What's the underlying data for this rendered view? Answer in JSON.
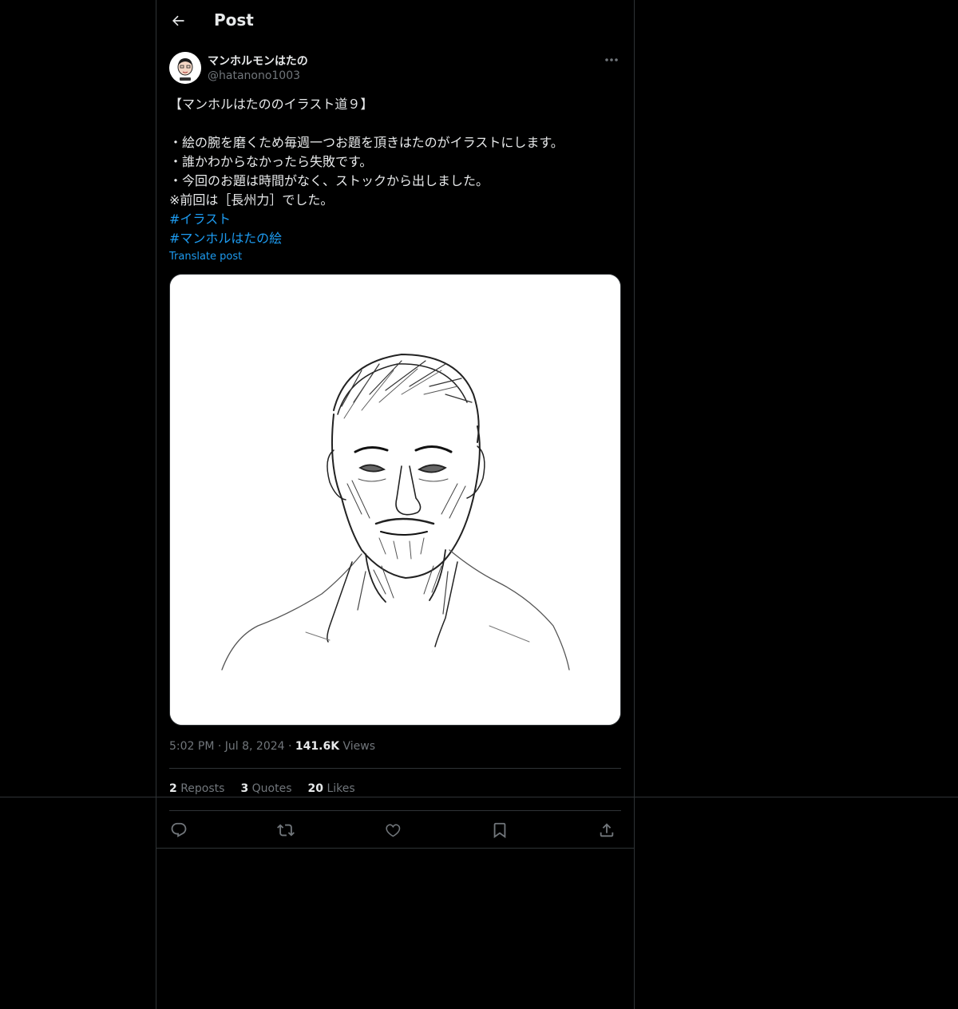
{
  "header": {
    "title": "Post",
    "back_icon": "arrow-left-icon"
  },
  "author": {
    "display_name": "マンホルモンはたの",
    "handle": "@hatanono1003"
  },
  "tweet": {
    "lines": [
      "【マンホルはたののイラスト道９】",
      "",
      "・絵の腕を磨くため毎週一つお題を頂きはたのがイラストにします。",
      "・誰かわからなかったら失敗です。",
      "・今回のお題は時間がなく、ストックから出しました。",
      "※前回は［長州力］でした。"
    ],
    "hashtags": [
      "#イラスト",
      "#マンホルはたの絵"
    ],
    "translate_label": "Translate post"
  },
  "meta": {
    "time": "5:02 PM",
    "separator": "·",
    "date": "Jul 8, 2024",
    "views_count": "141.6K",
    "views_label": "Views"
  },
  "stats": {
    "reposts_count": "2",
    "reposts_label": "Reposts",
    "quotes_count": "3",
    "quotes_label": "Quotes",
    "likes_count": "20",
    "likes_label": "Likes"
  },
  "actions": [
    "reply-icon",
    "repost-icon",
    "like-icon",
    "bookmark-icon",
    "share-icon"
  ],
  "colors": {
    "background": "#000000",
    "text": "#e7e9ea",
    "secondary": "#71767b",
    "link": "#1d9bf0",
    "border": "#2f3336"
  }
}
